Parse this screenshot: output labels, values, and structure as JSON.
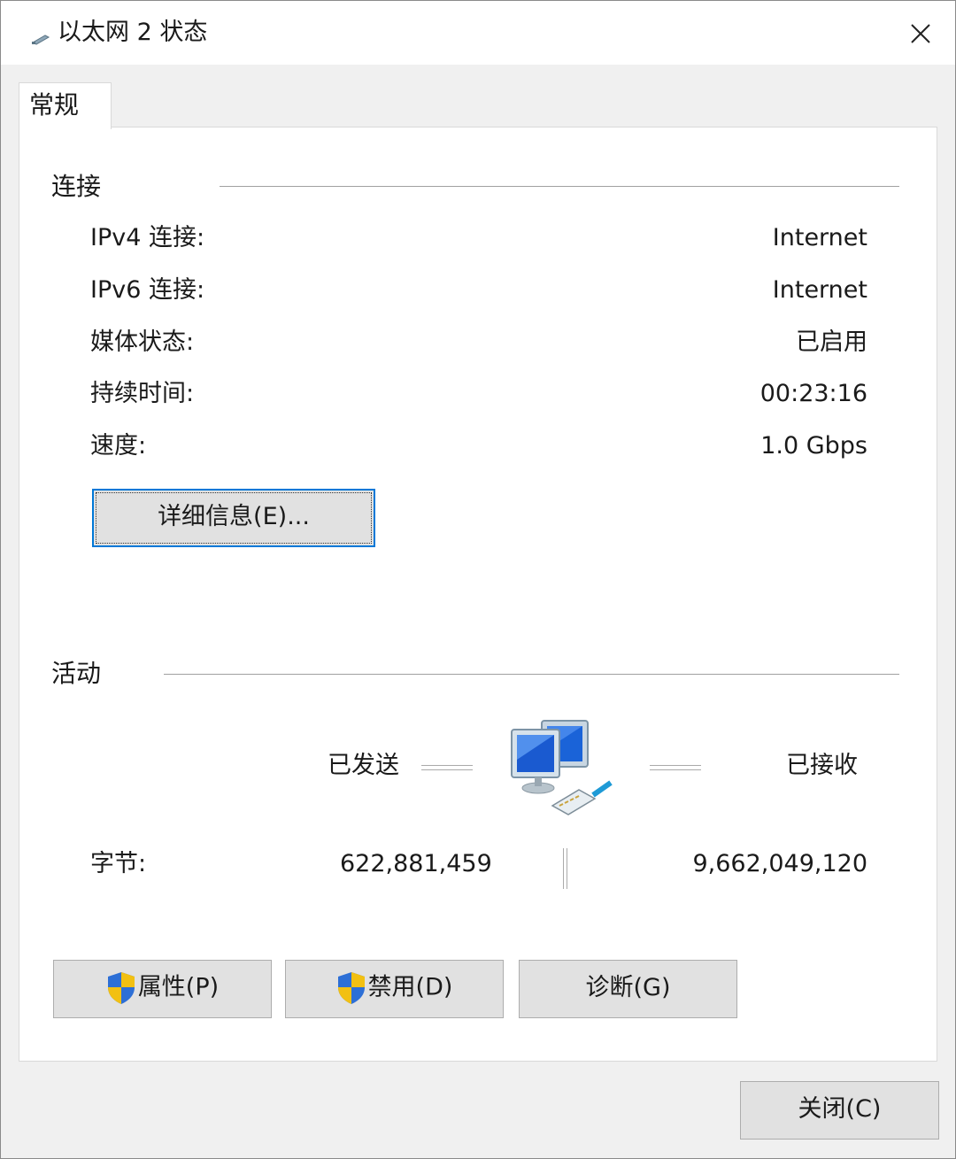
{
  "window": {
    "title": "以太网 2 状态",
    "close_label": "×"
  },
  "tabs": [
    {
      "label": "常规"
    }
  ],
  "connection": {
    "section_title": "连接",
    "rows": [
      {
        "label": "IPv4 连接:",
        "value": "Internet"
      },
      {
        "label": "IPv6 连接:",
        "value": "Internet"
      },
      {
        "label": "媒体状态:",
        "value": "已启用"
      },
      {
        "label": "持续时间:",
        "value": "00:23:16"
      },
      {
        "label": "速度:",
        "value": "1.0 Gbps"
      }
    ],
    "details_button": "详细信息(E)..."
  },
  "activity": {
    "section_title": "活动",
    "sent_label": "已发送",
    "received_label": "已接收",
    "bytes_label": "字节:",
    "bytes_sent": "622,881,459",
    "bytes_received": "9,662,049,120"
  },
  "buttons": {
    "properties": "属性(P)",
    "disable": "禁用(D)",
    "diagnose": "诊断(G)",
    "close": "关闭(C)"
  },
  "icons": {
    "title": "ethernet-cable-icon",
    "network": "network-computers-icon",
    "shield": "uac-shield-icon"
  },
  "colors": {
    "focus_border": "#0078d7",
    "button_bg": "#e1e1e1"
  }
}
